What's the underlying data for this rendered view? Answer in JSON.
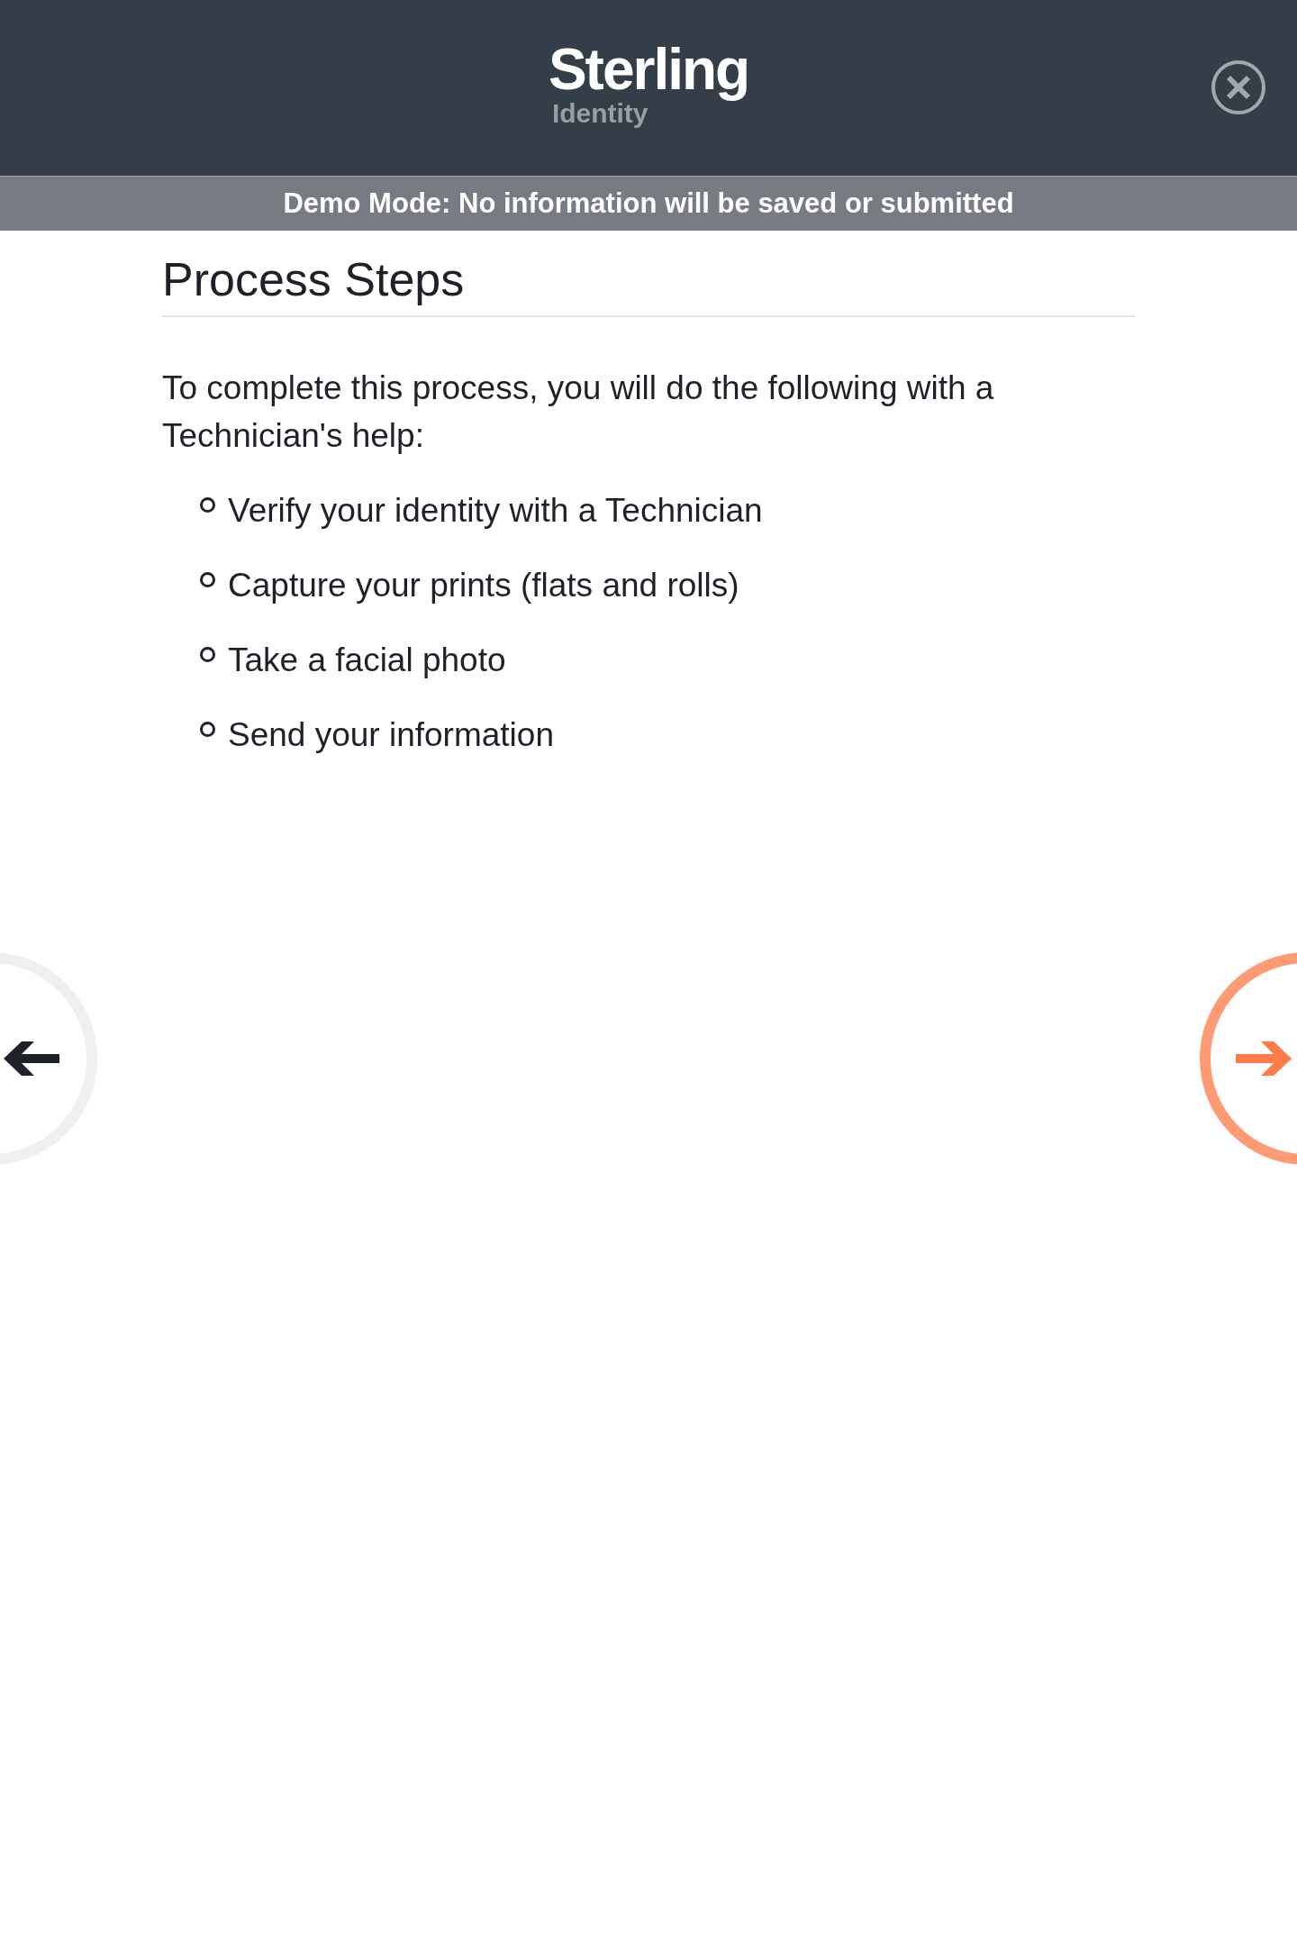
{
  "header": {
    "logo": {
      "name": "Sterling",
      "sub": "Identity"
    }
  },
  "demo_banner": "Demo Mode: No information will be saved or submitted",
  "title": "Process Steps",
  "intro": "To complete this process, you will do the following with a Technician's help:",
  "steps": [
    "Verify your identity with a Technician",
    "Capture your prints (flats and rolls)",
    "Take a facial photo",
    "Send your information"
  ],
  "nav": [
    {
      "kind": "back"
    },
    {
      "kind": "next"
    }
  ]
}
